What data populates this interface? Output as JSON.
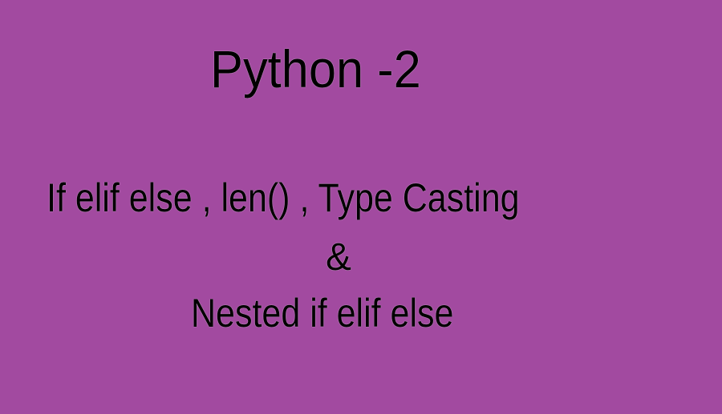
{
  "slide": {
    "background_color": "#a24aa0",
    "title": "Python -2",
    "subtitle_line1": "If elif else , len() , Type Casting",
    "ampersand": "&",
    "subtitle_line2": "Nested if elif else"
  }
}
